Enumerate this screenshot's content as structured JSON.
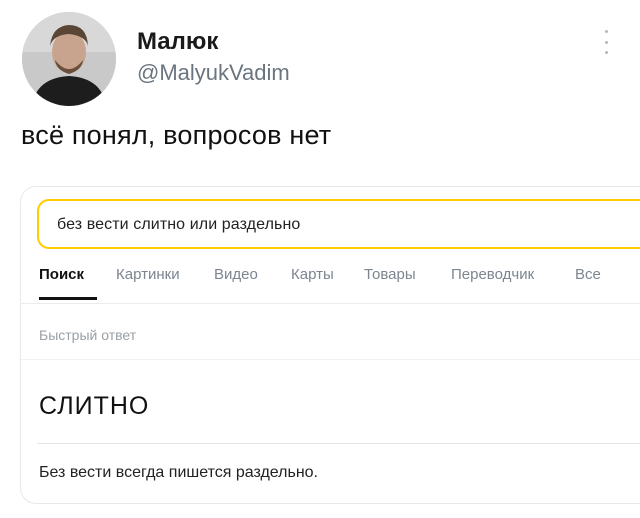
{
  "post": {
    "display_name": "Малюк",
    "handle": "@MalyukVadim",
    "text": "всё понял, вопросов нет",
    "more_icon": "more-vertical-icon"
  },
  "screenshot": {
    "search_query": "без вести слитно или раздельно",
    "tabs": [
      {
        "label": "Поиск",
        "active": true
      },
      {
        "label": "Картинки",
        "active": false
      },
      {
        "label": "Видео",
        "active": false
      },
      {
        "label": "Карты",
        "active": false
      },
      {
        "label": "Товары",
        "active": false
      },
      {
        "label": "Переводчик",
        "active": false
      },
      {
        "label": "Все",
        "active": false
      }
    ],
    "section_label": "Быстрый ответ",
    "answer_title": "СЛИТНО",
    "answer_body": "Без вести всегда пишется раздельно."
  },
  "colors": {
    "search_border": "#ffcc00",
    "handle": "#6b7580",
    "muted_tab": "#7c8590"
  }
}
